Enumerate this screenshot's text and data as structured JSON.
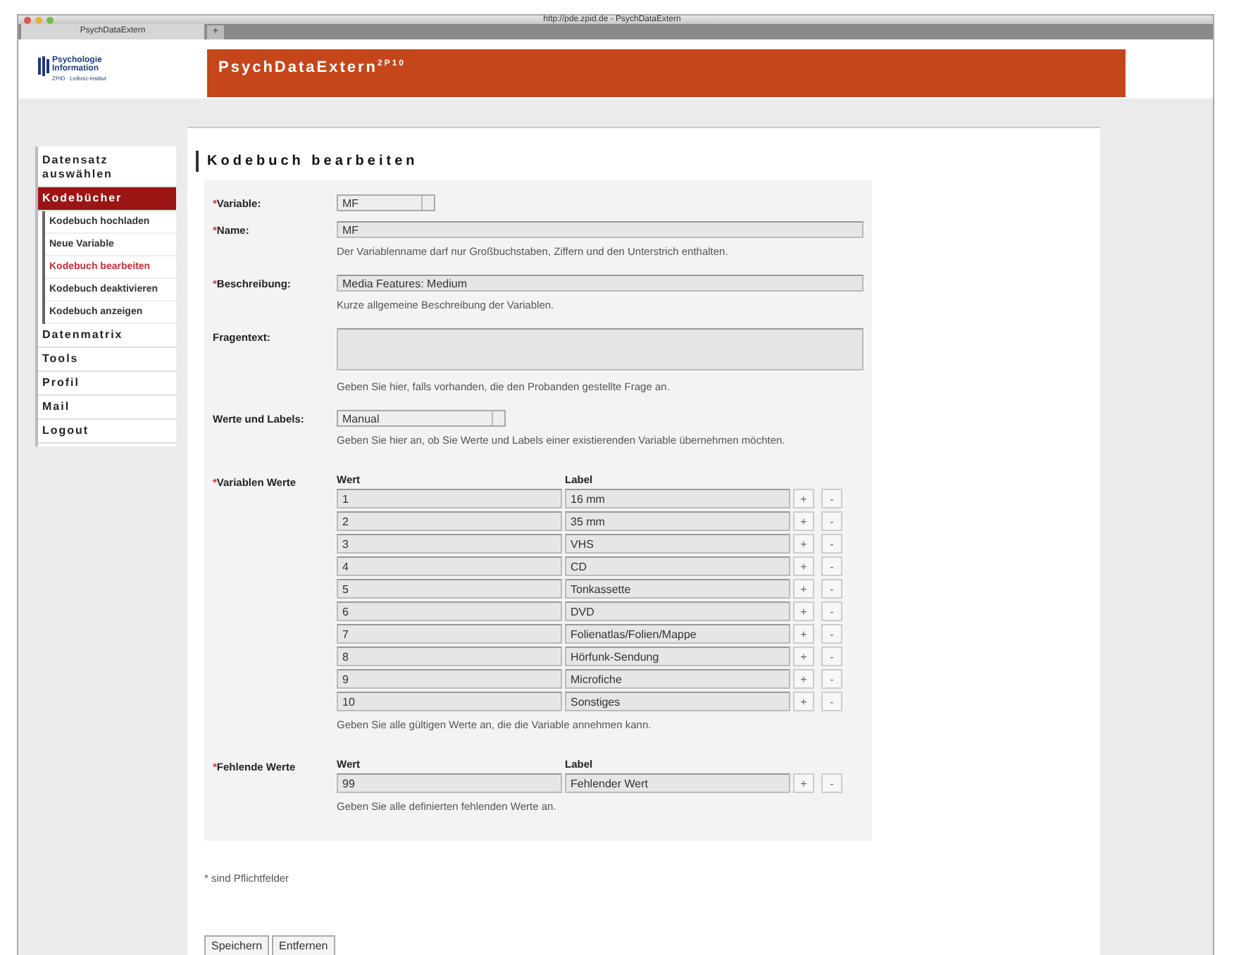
{
  "browser": {
    "window_title": "http://pde.zpid.de - PsychDataExtern",
    "tab_title": "PsychDataExtern",
    "new_tab": "+"
  },
  "header": {
    "logo_text": "Psychologie Information",
    "logo_subtext": "ZPID · Leibniz-Institut",
    "title": "PsychDataExtern$^{2P10}$"
  },
  "sidebar": {
    "items": [
      {
        "label": "Datensatz auswählen",
        "selected": false
      },
      {
        "label": "Kodebücher",
        "selected": true,
        "children": [
          {
            "label": "Kodebuch hochladen",
            "selected": false
          },
          {
            "label": "Neue Variable",
            "selected": false
          },
          {
            "label": "Kodebuch bearbeiten",
            "selected": true
          },
          {
            "label": "Kodebuch deaktivieren",
            "selected": false
          },
          {
            "label": "Kodebuch anzeigen",
            "selected": false
          }
        ]
      },
      {
        "label": "Datenmatrix",
        "selected": false
      },
      {
        "label": "Tools",
        "selected": false
      },
      {
        "label": "Profil",
        "selected": false
      },
      {
        "label": "Mail",
        "selected": false
      },
      {
        "label": "Logout",
        "selected": false
      }
    ]
  },
  "form": {
    "heading": "Kodebuch bearbeiten",
    "required_mark": "*",
    "fields": [
      {
        "kind": "select",
        "label": "Variable:",
        "required": true,
        "value": "MF"
      },
      {
        "kind": "text",
        "label": "Name:",
        "required": true,
        "value": "MF",
        "hint": "Der Variablenname darf nur Großbuchstaben, Ziffern und den Unterstrich enthalten."
      },
      {
        "kind": "text",
        "label": "Beschreibung:",
        "required": true,
        "value": "Media Features: Medium",
        "hint": "Kurze allgemeine Beschreibung der Variablen."
      },
      {
        "kind": "textarea",
        "label": "Fragentext:",
        "required": false,
        "hint": "Geben Sie hier, falls vorhanden, die den Probanden gestellte Frage an."
      },
      {
        "kind": "select",
        "label": "Werte und Labels:",
        "required": false,
        "value": "Manual",
        "hint": "Geben Sie hier an, ob Sie Werte und Labels einer existierenden Variable übernehmen möchten."
      }
    ],
    "value_tables": [
      {
        "label": "Variablen Werte",
        "required": true,
        "columns": [
          "Wert",
          "Label"
        ],
        "hint": "Geben Sie alle gültigen Werte an, die die Variable annehmen kann.",
        "rows": [
          {
            "value": "1",
            "label": "16 mm",
            "add": "+",
            "remove": "-"
          },
          {
            "value": "2",
            "label": "35 mm",
            "add": "+",
            "remove": "-"
          },
          {
            "value": "3",
            "label": "VHS",
            "add": "+",
            "remove": "-"
          },
          {
            "value": "4",
            "label": "CD",
            "add": "+",
            "remove": "-"
          },
          {
            "value": "5",
            "label": "Tonkassette",
            "add": "+",
            "remove": "-"
          },
          {
            "value": "6",
            "label": "DVD",
            "add": "+",
            "remove": "-"
          },
          {
            "value": "7",
            "label": "Folienatlas/Folien/Mappe",
            "add": "+",
            "remove": "-"
          },
          {
            "value": "8",
            "label": "Hörfunk-Sendung",
            "add": "+",
            "remove": "-"
          },
          {
            "value": "9",
            "label": "Microfiche",
            "add": "+",
            "remove": "-"
          },
          {
            "value": "10",
            "label": "Sonstiges",
            "add": "+",
            "remove": "-"
          }
        ]
      },
      {
        "label": "Fehlende Werte",
        "required": true,
        "columns": [
          "Wert",
          "Label"
        ],
        "hint": "Geben Sie alle definierten fehlenden Werte an.",
        "rows": [
          {
            "value": "99",
            "label": "Fehlender Wert",
            "add": "+",
            "remove": "-"
          }
        ]
      }
    ],
    "footnote": "* sind Pflichtfelder",
    "buttons": [
      "Speichern",
      "Entfernen"
    ]
  }
}
